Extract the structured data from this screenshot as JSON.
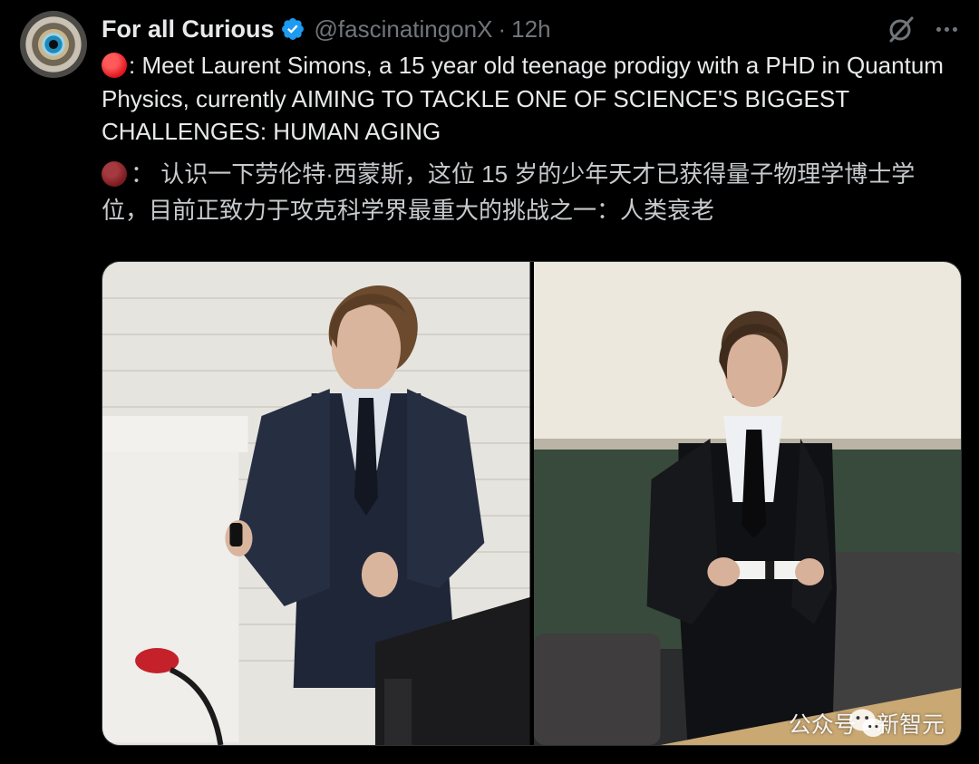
{
  "author": {
    "display_name": "For all Curious",
    "handle": "@fascinatingonX",
    "separator": "·",
    "time": "12h",
    "avatar_icon": "eye-avatar",
    "verified_icon": "verified-badge-icon"
  },
  "tweet": {
    "text": ": Meet Laurent Simons, a 15 year old teenage prodigy with a PHD in Quantum Physics, currently AIMING TO TACKLE ONE OF SCIENCE'S BIGGEST CHALLENGES: HUMAN AGING",
    "translation": "： 认识一下劳伦特·西蒙斯，这位 15 岁的少年天才已获得量子物理学博士学位，目前正致力于攻克科学界最重大的挑战之一：人类衰老",
    "emoji_icon": "red-circle-icon"
  },
  "actions": {
    "grok_icon": "grok-slash-icon",
    "more_icon": "more-icon"
  },
  "media": {
    "photos": [
      {
        "name": "lecture-photo"
      },
      {
        "name": "diploma-photo"
      }
    ],
    "watermark": "公众号 · 新智元",
    "watermark_icon": "wechat-icon"
  },
  "colors": {
    "background": "#000000",
    "text": "#e7e9ea",
    "secondary_text": "#71767b",
    "verified_blue": "#1d9bf0",
    "emoji_red": "#e0141f"
  }
}
